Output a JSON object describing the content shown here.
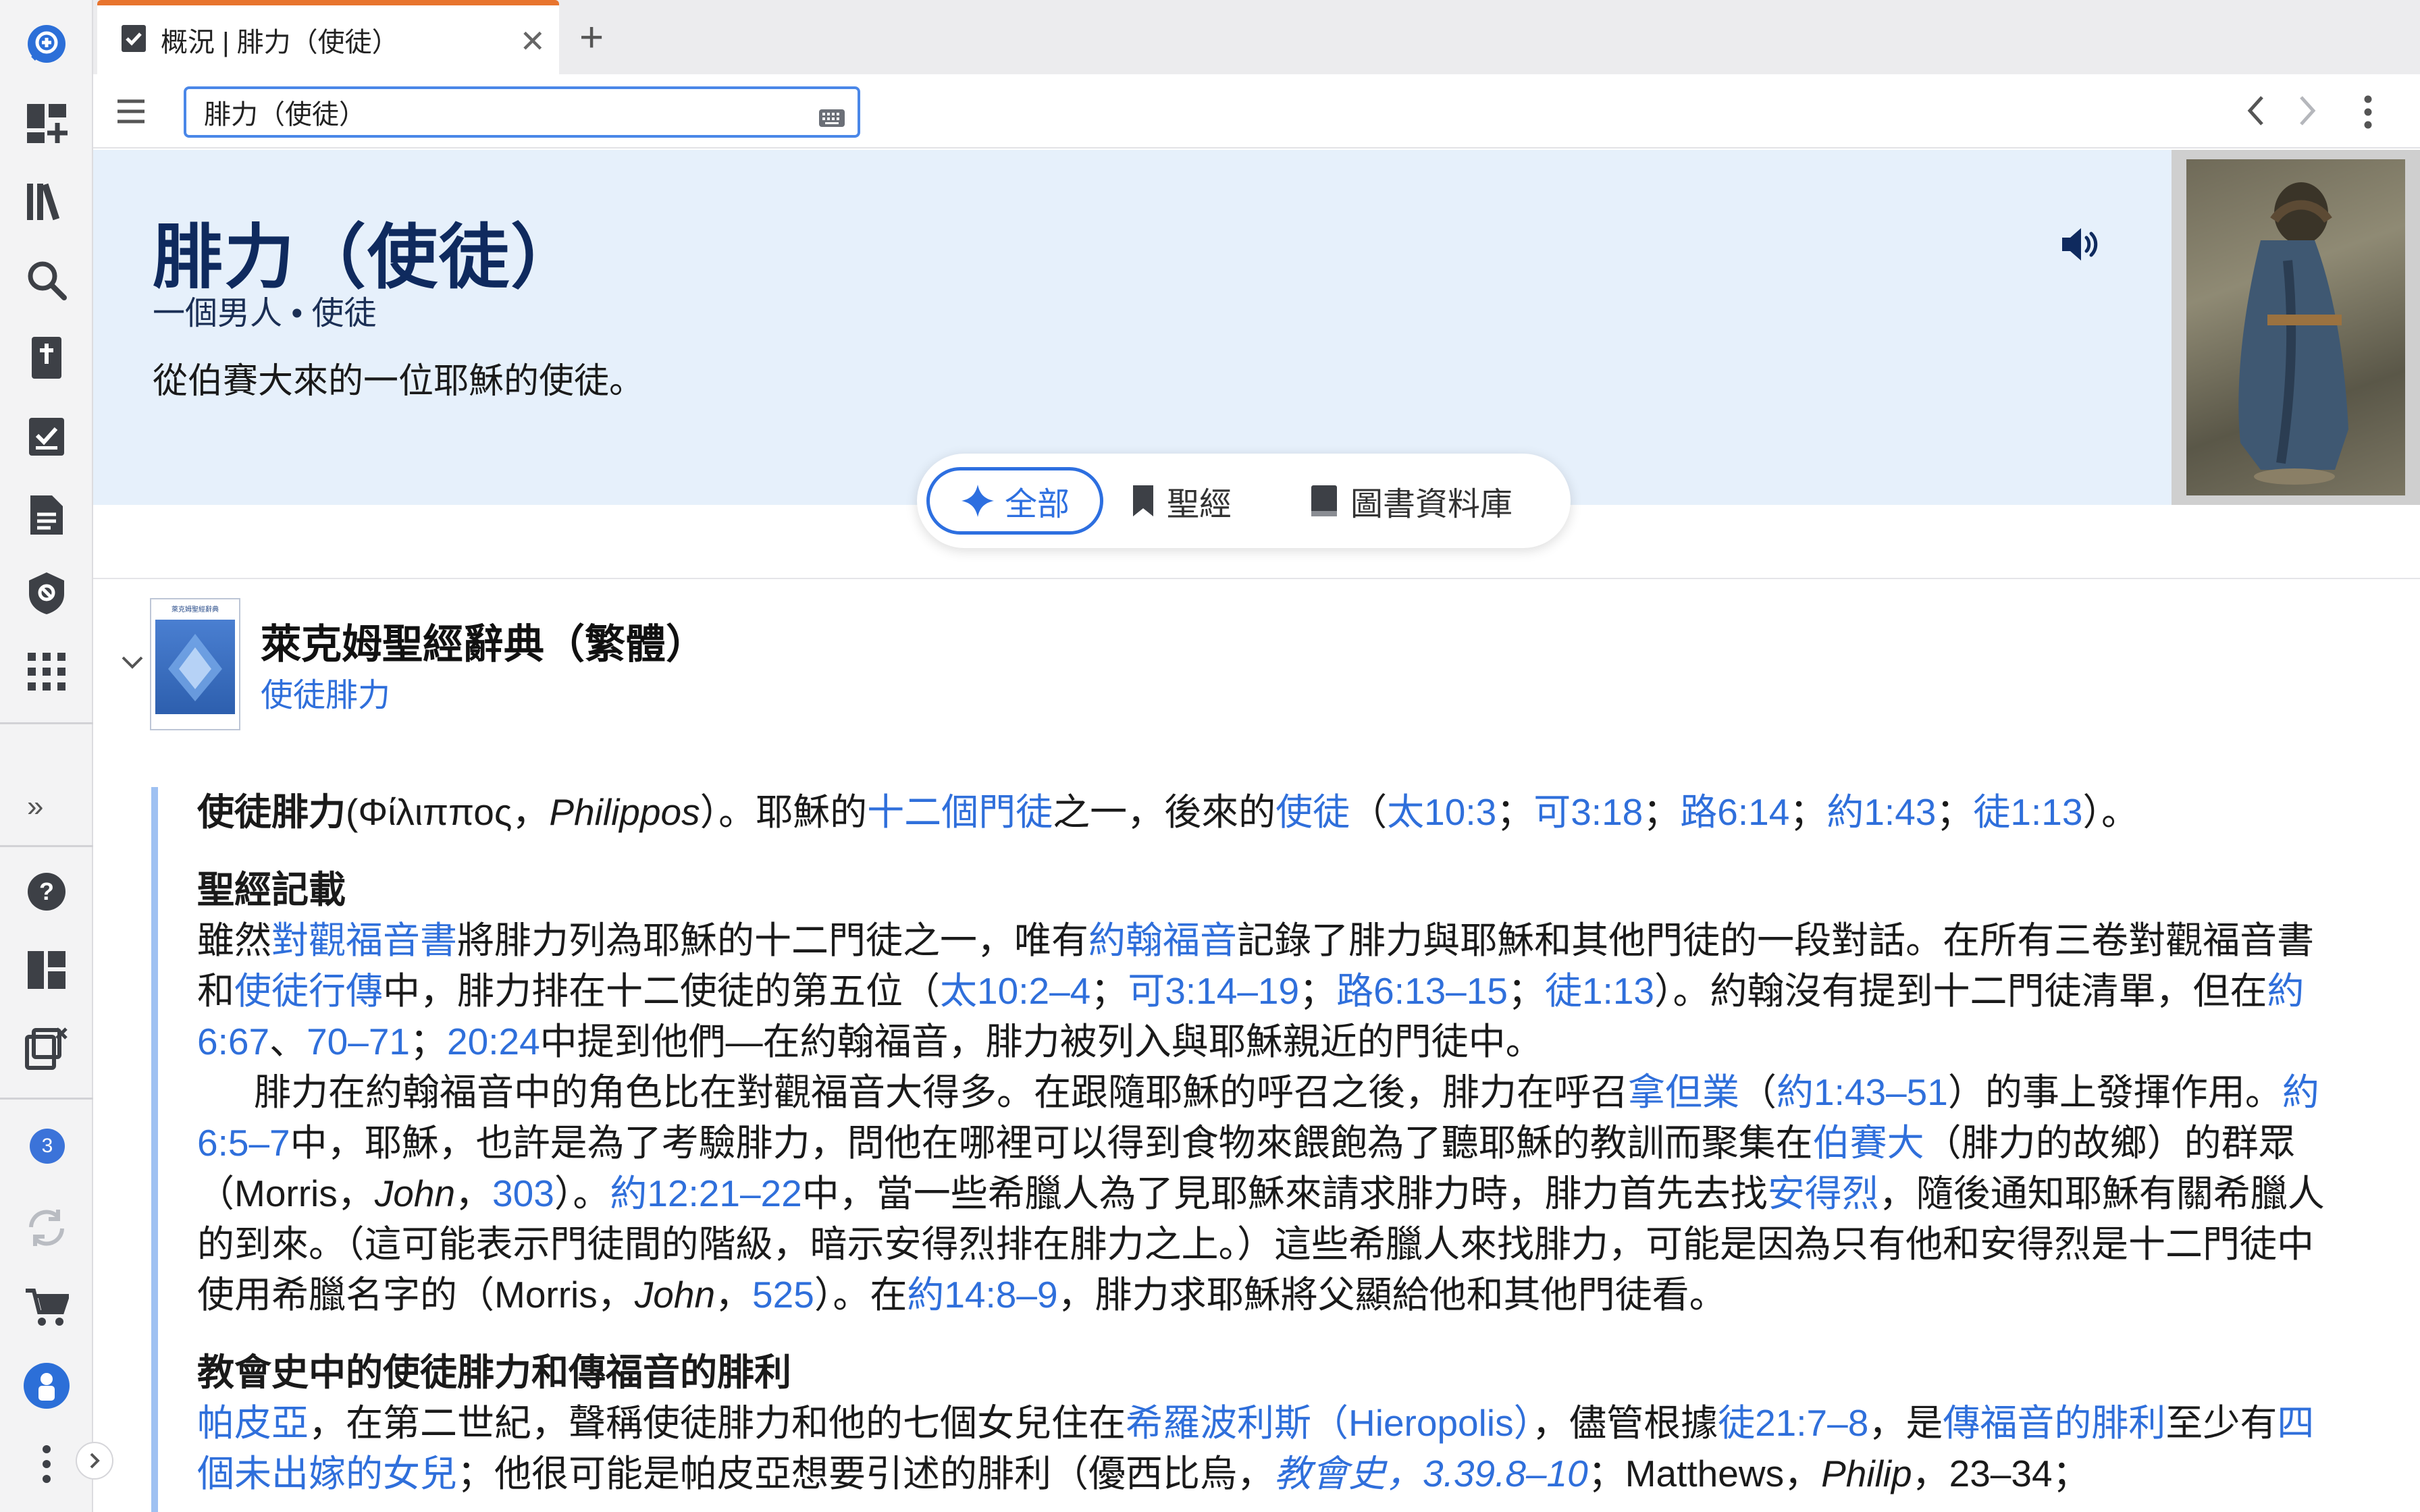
{
  "tab": {
    "title": "概況 | 腓力（使徒）",
    "close": "✕",
    "add": "+"
  },
  "toolbar": {
    "search_value": "腓力（使徒）"
  },
  "hero": {
    "title": "腓力（使徒）",
    "subtitle": "一個男人 • 使徒",
    "description": "從伯賽大來的一位耶穌的使徒。"
  },
  "filters": [
    {
      "label": "全部",
      "active": true
    },
    {
      "label": "聖經",
      "active": false
    },
    {
      "label": "圖書資料庫",
      "active": false
    }
  ],
  "resource": {
    "title": "萊克姆聖經辭典（繁體）",
    "link": "使徒腓力",
    "cover_text": "萊克姆聖經辭典"
  },
  "rail": {
    "notification_count": "3",
    "more": "»"
  },
  "article": {
    "lead": [
      "使徒腓力",
      "(Φίλιππος，",
      "Philippos",
      "）。耶穌的",
      "十二個門徒",
      "之一，後來的",
      "使徒",
      "（",
      "太10:3",
      "；",
      "可3:18",
      "；",
      "路6:14",
      "；",
      "約1:43",
      "；",
      "徒1:13",
      "）。"
    ],
    "section1_heading": "聖經記載",
    "p1": [
      "雖然",
      "對觀福音書",
      "將腓力列為耶穌的十二門徒之一，唯有",
      "約翰福音",
      "記錄了腓力與耶穌和其他門徒的一段對話。在所有三卷對觀福音書和",
      "使徒行傳",
      "中，腓力排在十二使徒的第五位（",
      "太10:2–4",
      "；",
      "可3:14–19",
      "；",
      "路6:13–15",
      "；",
      "徒1:13",
      "）。約翰沒有提到十二門徒清單，但在",
      "約6:67",
      "、",
      "70–71",
      "；",
      "20:24",
      "中提到他們—在約翰福音，腓力被列入與耶穌親近的門徒中。"
    ],
    "p2": [
      "腓力在約翰福音中的角色比在對觀福音大得多。在跟隨耶穌的呼召之後，腓力在呼召",
      "拿但業",
      "（",
      "約1:43–51",
      "）的事上發揮作用。",
      "約6:5–7",
      "中，耶穌，也許是為了考驗腓力，問他在哪裡可以得到食物來餵飽為了聽耶穌的教訓而聚集在",
      "伯賽大",
      "（腓力的故鄉）的群眾（Morris，",
      "John",
      "，",
      "303",
      "）。",
      "約12:21–22",
      "中，當一些希臘人為了見耶穌來請求腓力時，腓力首先去找",
      "安得烈",
      "，隨後通知耶穌有關希臘人的到來。（這可能表示門徒間的階級，暗示安得烈排在腓力之上。）這些希臘人來找腓力，可能是因為只有他和安得烈是十二門徒中使用希臘名字的（Morris，",
      "John",
      "，",
      "525",
      "）。在",
      "約14:8–9",
      "，腓力求耶穌將父顯給他和其他門徒看。"
    ],
    "section2_heading": "教會史中的使徒腓力和傳福音的腓利",
    "p3": [
      "帕皮亞",
      "，在第二世紀，聲稱使徒腓力和他的七個女兒住在",
      "希羅波利斯（Hieropolis）",
      "，儘管根據",
      "徒21:7–8",
      "，是",
      "傳福音的腓利",
      "至少有",
      "四個未出嫁的女兒",
      "；他很可能是帕皮亞想要引述的腓利（優西比烏，",
      "教會史，3.39.8–10",
      "；Matthews，",
      "Philip",
      "，23–34；"
    ]
  }
}
